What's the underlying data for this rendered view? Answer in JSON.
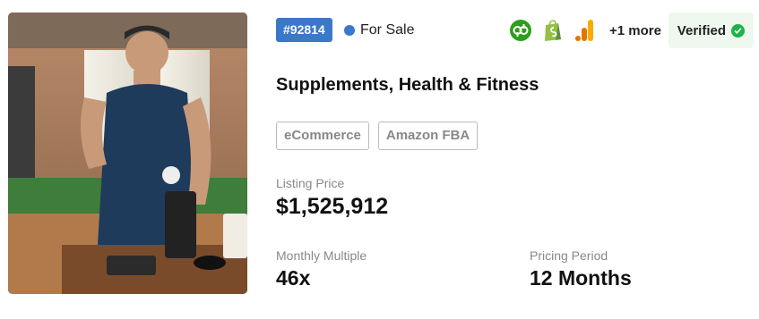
{
  "listing": {
    "id": "#92814",
    "status": "For Sale",
    "title": "Supplements, Health & Fitness",
    "tags": [
      "eCommerce",
      "Amazon FBA"
    ],
    "verified_label": "Verified",
    "more_integrations": "+1 more",
    "integrations": [
      "quickbooks-icon",
      "shopify-icon",
      "google-analytics-icon"
    ],
    "listing_price_label": "Listing Price",
    "listing_price": "$1,525,912",
    "monthly_multiple_label": "Monthly Multiple",
    "monthly_multiple": "46x",
    "pricing_period_label": "Pricing Period",
    "pricing_period": "12 Months"
  },
  "colors": {
    "id_badge": "#3a78c9",
    "status_dot": "#3a78c9",
    "verified_bg": "#eef8ee",
    "verified_check": "#1bb34a",
    "quickbooks": "#2ca01c",
    "shopify": "#95bf47",
    "analytics_orange": "#f9ab00",
    "analytics_dark": "#e37400"
  }
}
